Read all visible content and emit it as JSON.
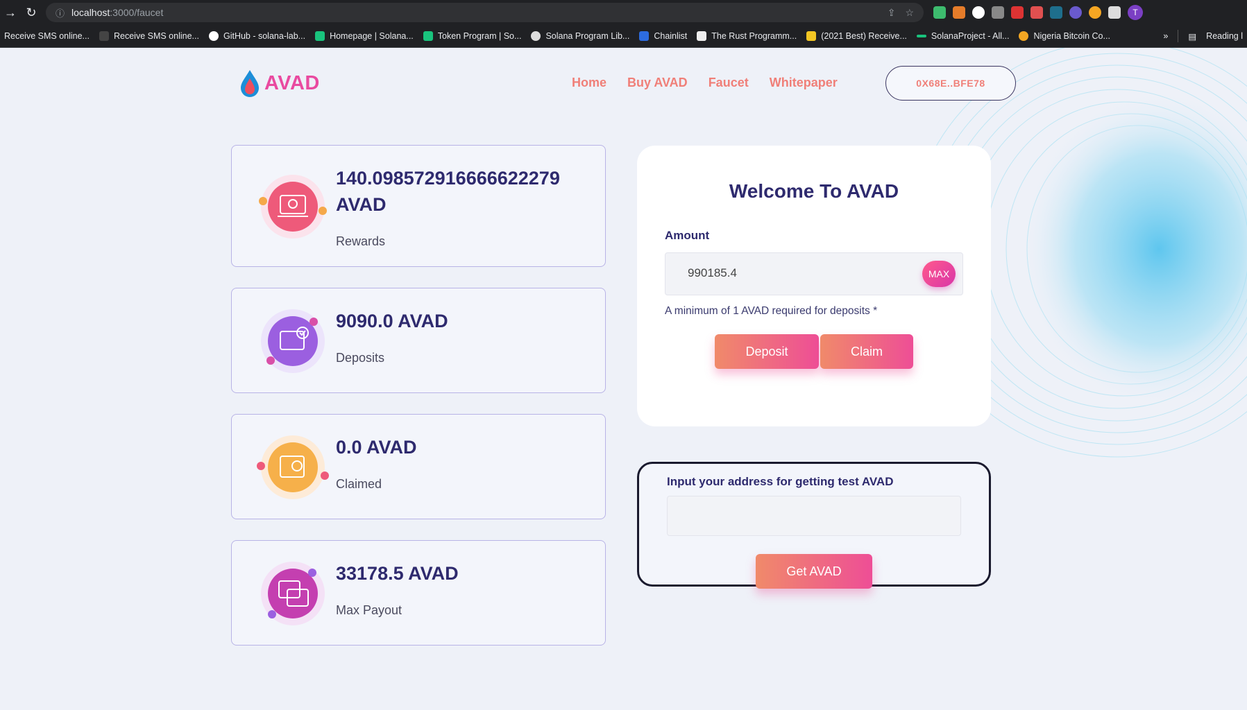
{
  "browser": {
    "url_host": "localhost",
    "url_path": ":3000/faucet",
    "avatar_letter": "T",
    "bookmarks": [
      "Receive SMS online...",
      "Receive SMS online...",
      "GitHub - solana-lab...",
      "Homepage | Solana...",
      "Token Program | So...",
      "Solana Program Lib...",
      "Chainlist",
      "The Rust Programm...",
      "(2021 Best) Receive...",
      "SolanaProject - All...",
      "Nigeria Bitcoin Co..."
    ],
    "more": "»",
    "reading_list": "Reading l"
  },
  "header": {
    "logo": "AVAD",
    "nav": [
      "Home",
      "Buy AVAD",
      "Faucet",
      "Whitepaper"
    ],
    "wallet": "0X68E..BFE78"
  },
  "stats": [
    {
      "value": "140.098572916666622279 AVAD",
      "label": "Rewards"
    },
    {
      "value": "9090.0 AVAD",
      "label": "Deposits"
    },
    {
      "value": "0.0 AVAD",
      "label": "Claimed"
    },
    {
      "value": "33178.5 AVAD",
      "label": "Max Payout"
    }
  ],
  "panel": {
    "title": "Welcome To AVAD",
    "amount_label": "Amount",
    "amount_value": "990185.4",
    "max_label": "MAX",
    "note": "A minimum of 1 AVAD required for deposits *",
    "deposit_label": "Deposit",
    "claim_label": "Claim"
  },
  "faucet": {
    "label": "Input your address for getting test AVAD",
    "address_value": "",
    "button_label": "Get AVAD"
  },
  "colors": {
    "brand_pink": "#e94aa0",
    "nav_coral": "#f07f78",
    "heading_navy": "#2e2a6e"
  }
}
